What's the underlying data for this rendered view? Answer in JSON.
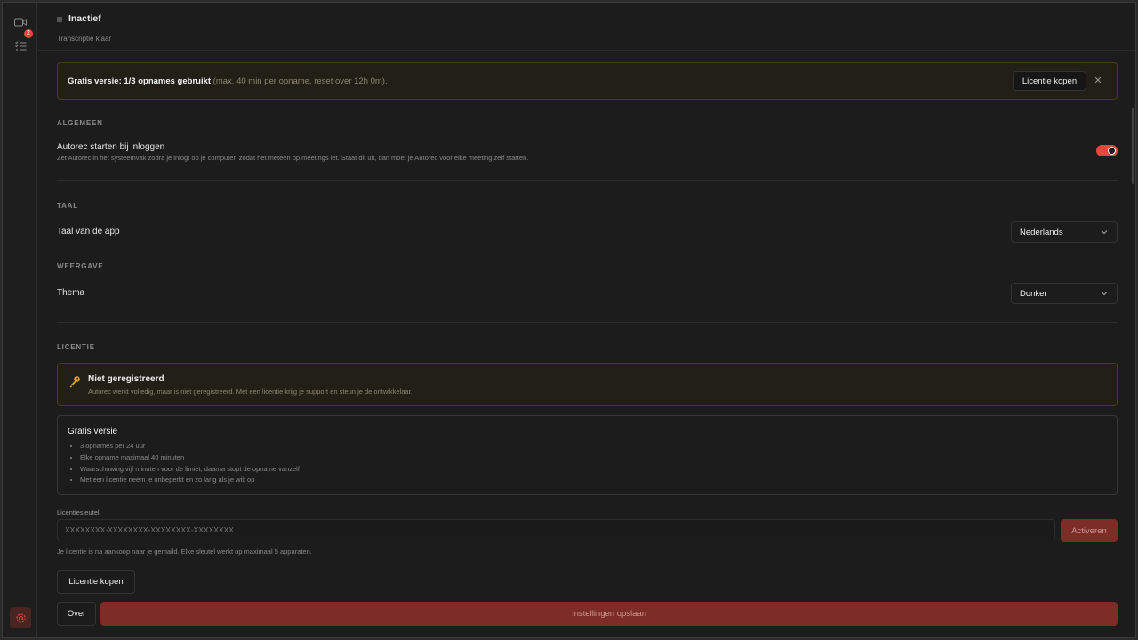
{
  "status": {
    "title": "Inactief",
    "subtitle": "Transcriptie klaar"
  },
  "sidebar": {
    "badge_count": "2"
  },
  "banner": {
    "main": "Gratis versie: 1/3 opnames gebruikt",
    "detail": " (max. 40 min per opname, reset over 12h 0m).",
    "buy_label": "Licentie kopen",
    "close": "✕"
  },
  "general": {
    "heading": "ALGEMEEN",
    "autostart_title": "Autorec starten bij inloggen",
    "autostart_desc": "Zet Autorec in het systeemvak zodra je inlogt op je computer, zodat het meteen op meetings let. Staat dit uit, dan moet je Autorec voor elke meeting zelf starten.",
    "autostart_on": true
  },
  "language": {
    "heading": "TAAL",
    "label": "Taal van de app",
    "value": "Nederlands"
  },
  "display": {
    "heading": "WEERGAVE",
    "label": "Thema",
    "value": "Donker"
  },
  "license": {
    "heading": "LICENTIE",
    "notice_title": "Niet geregistreerd",
    "notice_desc": "Autorec werkt volledig, maar is niet geregistreerd. Met een licentie krijg je support en steun je de ontwikkelaar.",
    "free_title": "Gratis versie",
    "free_items": [
      "3 opnames per 24 uur",
      "Elke opname maximaal 40 minuten",
      "Waarschuwing vijf minuten voor de limiet, daarna stopt de opname vanzelf",
      "Met een licentie neem je onbeperkt en zo lang als je wilt op"
    ],
    "key_label": "Licentiesleutel",
    "key_placeholder": "XXXXXXXX-XXXXXXXX-XXXXXXXX-XXXXXXXX",
    "activate_label": "Activeren",
    "key_hint": "Je licentie is na aankoop naar je gemaild. Elke sleutel werkt op maximaal 5 apparaten.",
    "buy_label": "Licentie kopen"
  },
  "footer": {
    "about_label": "Over",
    "save_label": "Instellingen opslaan"
  },
  "colors": {
    "accent": "#e5483b",
    "warning_border": "#4a3d16",
    "background": "#1c1c1c"
  }
}
